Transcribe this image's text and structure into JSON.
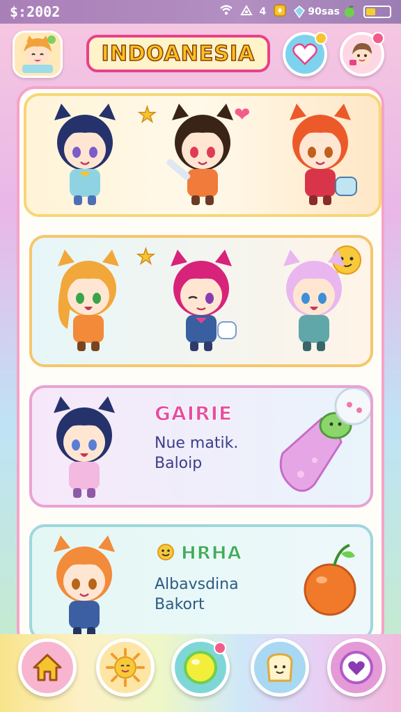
{
  "status_bar": {
    "money": "$:2002",
    "signal_icon": "wifi-icon",
    "mid_value": "4",
    "gem_label": "90sas",
    "battery_level": 0.4
  },
  "header": {
    "title": "INDOANESIA"
  },
  "cards": [
    {
      "id": "row-1",
      "title": "",
      "lines": []
    },
    {
      "id": "row-2",
      "title": "",
      "lines": []
    },
    {
      "id": "row-3",
      "title": "GAIRIE",
      "lines": [
        "Nue matik.",
        "Baloip"
      ]
    },
    {
      "id": "row-4",
      "title": "HRHA",
      "lines": [
        "Albavsdina",
        "Bakort"
      ]
    }
  ],
  "nav": {
    "items": [
      "home-icon",
      "sun-icon",
      "orb-icon",
      "bread-icon",
      "heart-icon"
    ]
  },
  "colors": {
    "accent_pink": "#e8418b",
    "title_yellow": "#f7c31c",
    "panel_border": "#f5a3c7"
  }
}
